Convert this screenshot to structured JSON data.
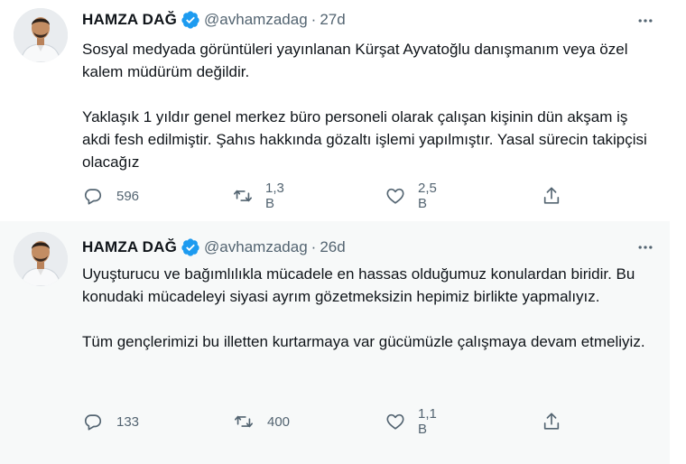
{
  "colors": {
    "verified_blue": "#1d9bf0",
    "text_primary": "#0f1419",
    "text_secondary": "#536471",
    "thread_line": "#cfd9de",
    "second_tweet_bg": "#f7f9f9"
  },
  "tweets": [
    {
      "author": {
        "name": "HAMZA DAĞ",
        "handle": "@avhamzadag",
        "verified": true,
        "avatar_icon": "avatar-photo"
      },
      "separator": "·",
      "time": "27d",
      "text": [
        "Sosyal medyada görüntüleri yayınlanan Kürşat Ayvatoğlu danışmanım veya özel kalem müdürüm değildir.",
        "Yaklaşık 1 yıldır genel merkez büro personeli olarak çalışan kişinin dün akşam iş akdi fesh edilmiştir. Şahıs hakkında gözaltı işlemi yapılmıştır. Yasal sürecin takipçisi olacağız"
      ],
      "actions": {
        "reply_count": "596",
        "retweet_count": "1,3 B",
        "like_count": "2,5 B"
      }
    },
    {
      "author": {
        "name": "HAMZA DAĞ",
        "handle": "@avhamzadag",
        "verified": true,
        "avatar_icon": "avatar-photo"
      },
      "separator": "·",
      "time": "26d",
      "text": [
        "Uyuşturucu ve bağımlılıkla mücadele en hassas olduğumuz konulardan biridir. Bu konudaki mücadeleyi siyasi ayrım gözetmeksizin hepimiz birlikte yapmalıyız.",
        "Tüm gençlerimizi bu illetten kurtarmaya var gücümüzle çalışmaya devam etmeliyiz."
      ],
      "actions": {
        "reply_count": "133",
        "retweet_count": "400",
        "like_count": "1,1 B"
      }
    }
  ],
  "icons": {
    "reply": "reply-icon",
    "retweet": "retweet-icon",
    "like": "heart-icon",
    "share": "share-icon",
    "more": "more-icon",
    "verified": "verified-badge-icon"
  }
}
